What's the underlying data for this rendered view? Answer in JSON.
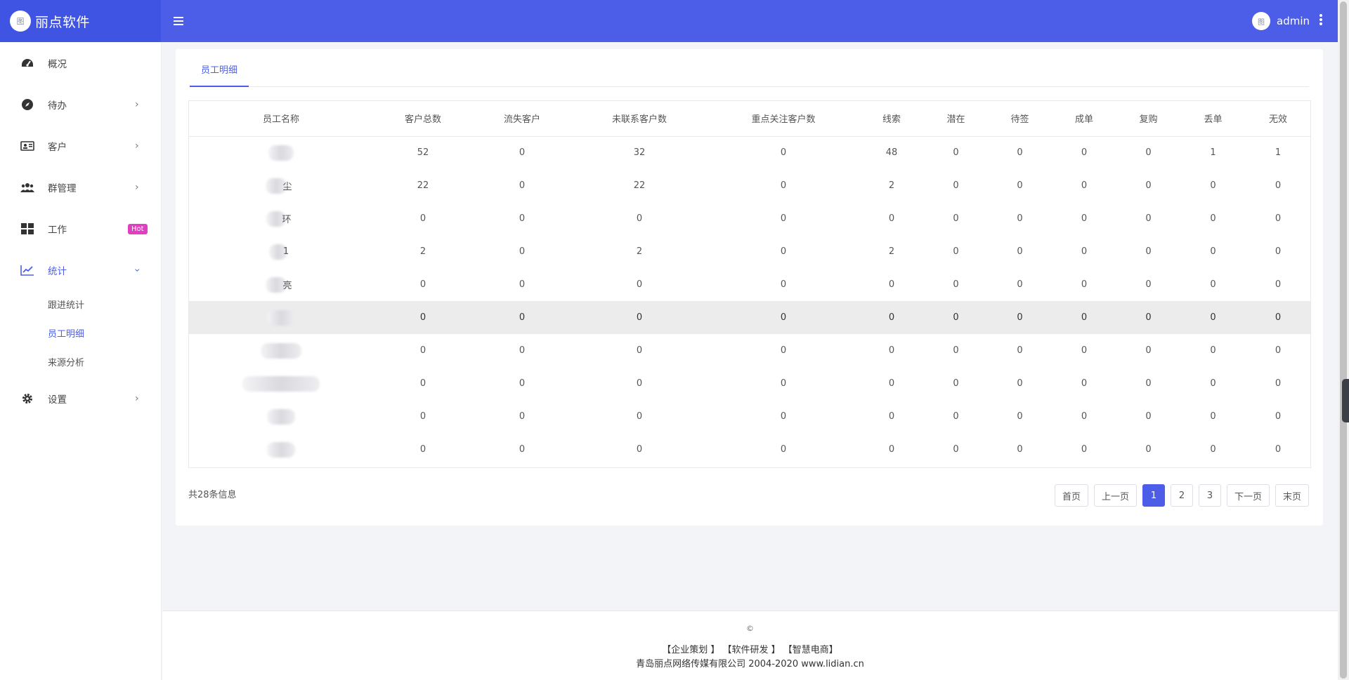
{
  "brand": {
    "logo_text": "图",
    "title": "丽点软件"
  },
  "header": {
    "menu_icon": "hamburger-icon",
    "avatar_text": "图",
    "username": "admin",
    "more_icon": "kebab-icon"
  },
  "sidebar": {
    "items": [
      {
        "label": "概况",
        "icon": "dashboard-icon"
      },
      {
        "label": "待办",
        "icon": "compass-icon",
        "chevron": "›"
      },
      {
        "label": "客户",
        "icon": "contact-card-icon",
        "chevron": "›"
      },
      {
        "label": "群管理",
        "icon": "users-icon",
        "chevron": "›"
      },
      {
        "label": "工作",
        "icon": "grid-icon",
        "badge": "Hot"
      },
      {
        "label": "统计",
        "icon": "chart-icon",
        "chevron": "›"
      },
      {
        "label": "设置",
        "icon": "gear-icon",
        "chevron": "›"
      }
    ],
    "sub_items": [
      {
        "label": "跟进统计"
      },
      {
        "label": "员工明细"
      },
      {
        "label": "来源分析"
      }
    ]
  },
  "main": {
    "tab": "员工明细",
    "table": {
      "headers": [
        "员工名称",
        "客户总数",
        "流失客户",
        "未联系客户数",
        "重点关注客户数",
        "线索",
        "潜在",
        "待签",
        "成单",
        "复购",
        "丢单",
        "无效"
      ],
      "rows": [
        {
          "name_tail": "",
          "values": [
            "52",
            "0",
            "32",
            "0",
            "48",
            "0",
            "0",
            "0",
            "0",
            "1",
            "1"
          ]
        },
        {
          "name_tail": "尘",
          "values": [
            "22",
            "0",
            "22",
            "0",
            "2",
            "0",
            "0",
            "0",
            "0",
            "0",
            "0"
          ]
        },
        {
          "name_tail": "环",
          "values": [
            "0",
            "0",
            "0",
            "0",
            "0",
            "0",
            "0",
            "0",
            "0",
            "0",
            "0"
          ]
        },
        {
          "name_tail": "1",
          "values": [
            "2",
            "0",
            "2",
            "0",
            "2",
            "0",
            "0",
            "0",
            "0",
            "0",
            "0"
          ]
        },
        {
          "name_tail": "亮",
          "values": [
            "0",
            "0",
            "0",
            "0",
            "0",
            "0",
            "0",
            "0",
            "0",
            "0",
            "0"
          ]
        },
        {
          "name_tail": "",
          "values": [
            "0",
            "0",
            "0",
            "0",
            "0",
            "0",
            "0",
            "0",
            "0",
            "0",
            "0"
          ]
        },
        {
          "name_tail": "",
          "values": [
            "0",
            "0",
            "0",
            "0",
            "0",
            "0",
            "0",
            "0",
            "0",
            "0",
            "0"
          ]
        },
        {
          "name_tail": "",
          "values": [
            "0",
            "0",
            "0",
            "0",
            "0",
            "0",
            "0",
            "0",
            "0",
            "0",
            "0"
          ]
        },
        {
          "name_tail": "",
          "values": [
            "0",
            "0",
            "0",
            "0",
            "0",
            "0",
            "0",
            "0",
            "0",
            "0",
            "0"
          ]
        },
        {
          "name_tail": "",
          "values": [
            "0",
            "0",
            "0",
            "0",
            "0",
            "0",
            "0",
            "0",
            "0",
            "0",
            "0"
          ]
        }
      ]
    },
    "total_info": "共28条信息",
    "pager": {
      "first": "首页",
      "prev": "上一页",
      "pages": [
        "1",
        "2",
        "3"
      ],
      "next": "下一页",
      "last": "末页"
    }
  },
  "footer": {
    "copyright": "©",
    "links": [
      "【企业策划 】",
      "【软件研发 】",
      "【智慧电商】"
    ],
    "company": "青岛丽点网络传媒有限公司 2004-2020 www.lidian.cn"
  },
  "colors": {
    "primary": "#4c5ee8",
    "brand_bg": "#3f54e3",
    "hot_badge": "#e040c0",
    "highlight_row": "#ececec"
  }
}
